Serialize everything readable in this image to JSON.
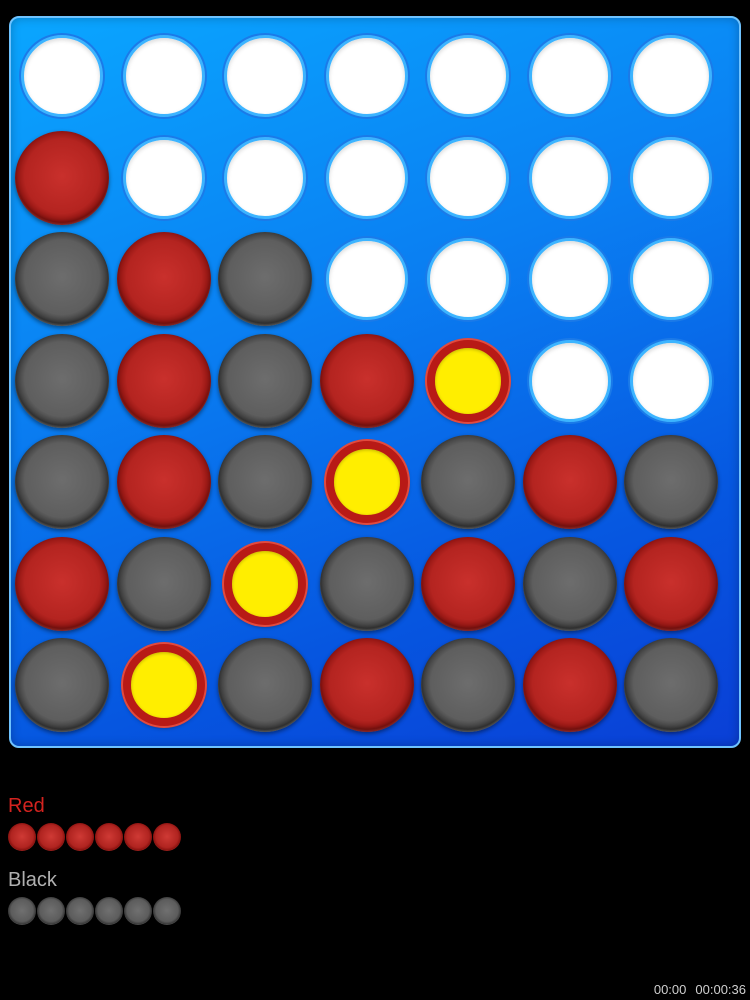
{
  "board": {
    "columns": 7,
    "rows": 7,
    "grid": [
      [
        "empty",
        "empty",
        "empty",
        "empty",
        "empty",
        "empty",
        "empty"
      ],
      [
        "red",
        "empty",
        "empty",
        "empty",
        "empty",
        "empty",
        "empty"
      ],
      [
        "black",
        "red",
        "black",
        "empty",
        "empty",
        "empty",
        "empty"
      ],
      [
        "black",
        "red",
        "black",
        "red",
        "win",
        "empty",
        "empty"
      ],
      [
        "black",
        "red",
        "black",
        "win",
        "black",
        "red",
        "black"
      ],
      [
        "red",
        "black",
        "win",
        "black",
        "red",
        "black",
        "red"
      ],
      [
        "black",
        "win",
        "black",
        "red",
        "black",
        "red",
        "black"
      ]
    ]
  },
  "players": [
    {
      "name": "Red",
      "color": "#d4231f",
      "piece": "red",
      "remaining": 6
    },
    {
      "name": "Black",
      "color": "#b0b0b0",
      "piece": "black",
      "remaining": 6
    }
  ],
  "timers": {
    "left": "00:00",
    "right": "00:00:36"
  },
  "colors": {
    "board_blue": "#0a7ff2",
    "win_highlight": "#ffee00"
  }
}
